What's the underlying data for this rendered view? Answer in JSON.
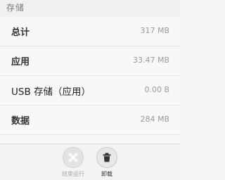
{
  "section": {
    "title": "存储"
  },
  "rows": [
    {
      "label": "总计",
      "value": "317 MB"
    },
    {
      "label": "应用",
      "value": "33.47 MB"
    },
    {
      "label": "USB 存储（应用）",
      "value": "0.00 B"
    },
    {
      "label": "数据",
      "value": "284 MB"
    }
  ],
  "actions": {
    "force_stop": {
      "label": "结束运行",
      "icon": "close-icon",
      "enabled": false
    },
    "uninstall": {
      "label": "卸载",
      "icon": "trash-icon",
      "enabled": true
    }
  },
  "colors": {
    "background": "#f4f4f4",
    "text_primary": "#333333",
    "text_secondary": "#9b9b9b",
    "disabled": "#a8a8a8"
  }
}
